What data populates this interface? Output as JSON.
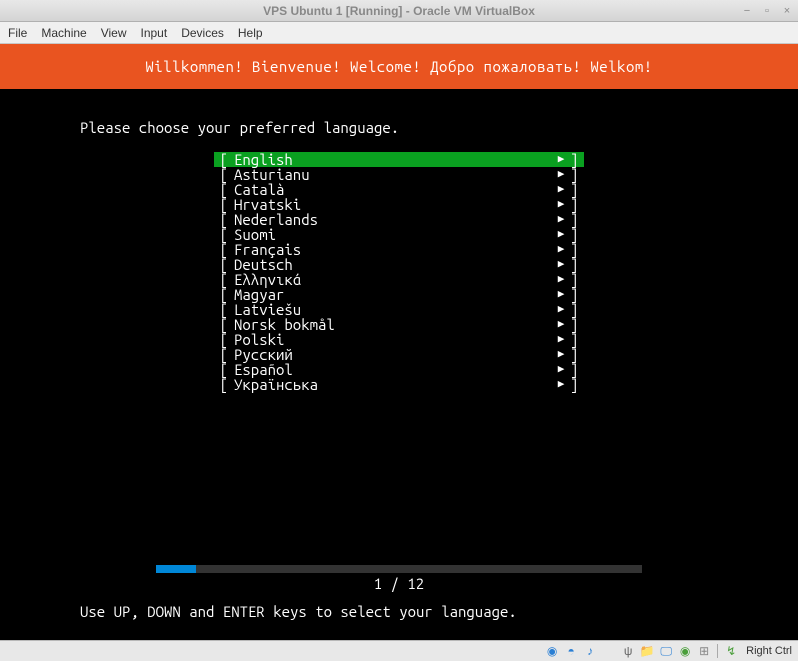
{
  "window": {
    "title": "VPS Ubuntu 1 [Running] - Oracle VM VirtualBox"
  },
  "menubar": {
    "items": [
      "File",
      "Machine",
      "View",
      "Input",
      "Devices",
      "Help"
    ]
  },
  "installer": {
    "welcome": "Willkommen! Bienvenue! Welcome! Добро пожаловать! Welkom!",
    "prompt": "Please choose your preferred language.",
    "languages": [
      {
        "name": "English",
        "selected": true
      },
      {
        "name": "Asturianu",
        "selected": false
      },
      {
        "name": "Català",
        "selected": false
      },
      {
        "name": "Hrvatski",
        "selected": false
      },
      {
        "name": "Nederlands",
        "selected": false
      },
      {
        "name": "Suomi",
        "selected": false
      },
      {
        "name": "Français",
        "selected": false
      },
      {
        "name": "Deutsch",
        "selected": false
      },
      {
        "name": "Ελληνικά",
        "selected": false
      },
      {
        "name": "Magyar",
        "selected": false
      },
      {
        "name": "Latviešu",
        "selected": false
      },
      {
        "name": "Norsk bokmål",
        "selected": false
      },
      {
        "name": "Polski",
        "selected": false
      },
      {
        "name": "Русский",
        "selected": false
      },
      {
        "name": "Español",
        "selected": false
      },
      {
        "name": "Українська",
        "selected": false
      }
    ],
    "progress": {
      "current": 1,
      "total": 12,
      "text": "1 / 12",
      "percent": 8.3
    },
    "hint": "Use UP, DOWN and ENTER keys to select your language."
  },
  "statusbar": {
    "host_key": "Right Ctrl"
  }
}
